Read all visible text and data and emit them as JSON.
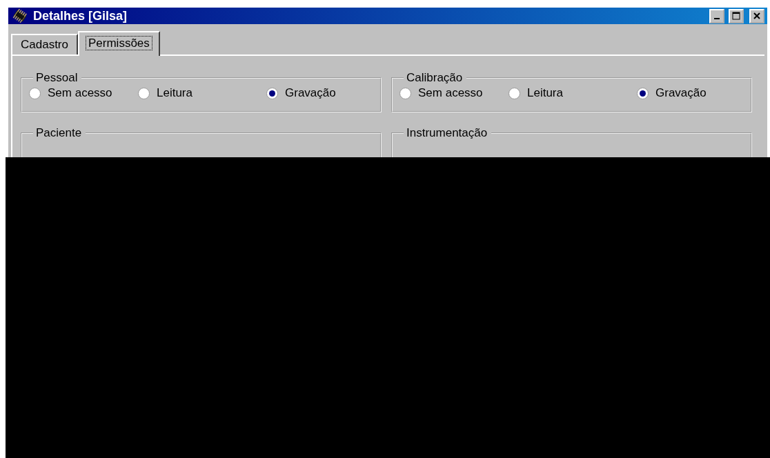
{
  "window": {
    "title": "Detalhes [Gilsa]"
  },
  "tabs": [
    {
      "label": "Cadastro",
      "selected": false
    },
    {
      "label": "Permissões",
      "selected": true
    }
  ],
  "groups": [
    {
      "title": "Pessoal",
      "options": [
        {
          "label": "Sem acesso",
          "selected": false
        },
        {
          "label": "Leitura",
          "selected": false
        },
        {
          "label": "Gravação",
          "selected": true
        }
      ]
    },
    {
      "title": "Calibração",
      "options": [
        {
          "label": "Sem acesso",
          "selected": false
        },
        {
          "label": "Leitura",
          "selected": false
        },
        {
          "label": "Gravação",
          "selected": true
        }
      ]
    },
    {
      "title": "Paciente"
    },
    {
      "title": "Instrumentação"
    }
  ]
}
